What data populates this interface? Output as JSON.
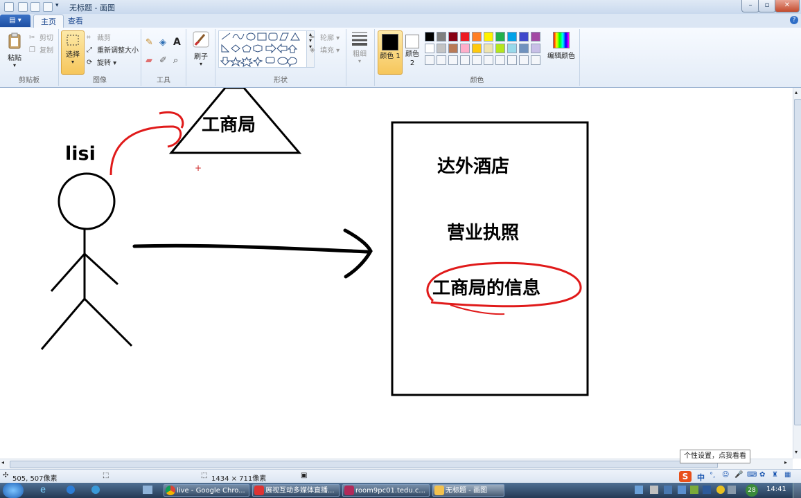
{
  "window": {
    "title": "无标题 - 画图"
  },
  "tabs": {
    "file": "▤ ▾",
    "home": "主页",
    "view": "查看"
  },
  "ribbon": {
    "clipboard": {
      "paste": "粘贴",
      "cut": "剪切",
      "copy": "复制",
      "label": "剪贴板"
    },
    "image": {
      "select": "选择",
      "crop": "裁剪",
      "resize": "重新调整大小",
      "rotate": "旋转",
      "label": "图像"
    },
    "tools": {
      "label": "工具"
    },
    "brushes": {
      "label": "刷子"
    },
    "shapes": {
      "outline": "轮廓",
      "fill": "填充",
      "label": "形状"
    },
    "size": {
      "label": "粗细"
    },
    "colors": {
      "color1": "颜色 1",
      "color2": "颜色 2",
      "edit": "编辑颜色",
      "label": "颜色",
      "palette_row1": [
        "#000000",
        "#7f7f7f",
        "#880015",
        "#ed1c24",
        "#ff7f27",
        "#fff200",
        "#22b14c",
        "#00a2e8",
        "#3f48cc",
        "#a349a4"
      ],
      "palette_row2": [
        "#ffffff",
        "#c3c3c3",
        "#b97a57",
        "#ffaec9",
        "#ffc90e",
        "#efe4b0",
        "#b5e61d",
        "#99d9ea",
        "#7092be",
        "#c8bfe7"
      ]
    }
  },
  "canvas": {
    "person_label": "lisi",
    "triangle_label": "工商局",
    "box_line1": "达外酒店",
    "box_line2": "营业执照",
    "box_line3": "工商局的信息"
  },
  "status": {
    "cursor_pos": "505, 507像素",
    "canvas_size": "1434 × 711像素"
  },
  "tooltip": "个性设置，点我看看",
  "taskbar": {
    "items": [
      "live - Google Chro...",
      "展视互动多媒体直播...",
      "room9pc01.tedu.c...",
      "无标题 - 画图"
    ],
    "ime": "中",
    "clock": "14:41",
    "badge": "28"
  }
}
